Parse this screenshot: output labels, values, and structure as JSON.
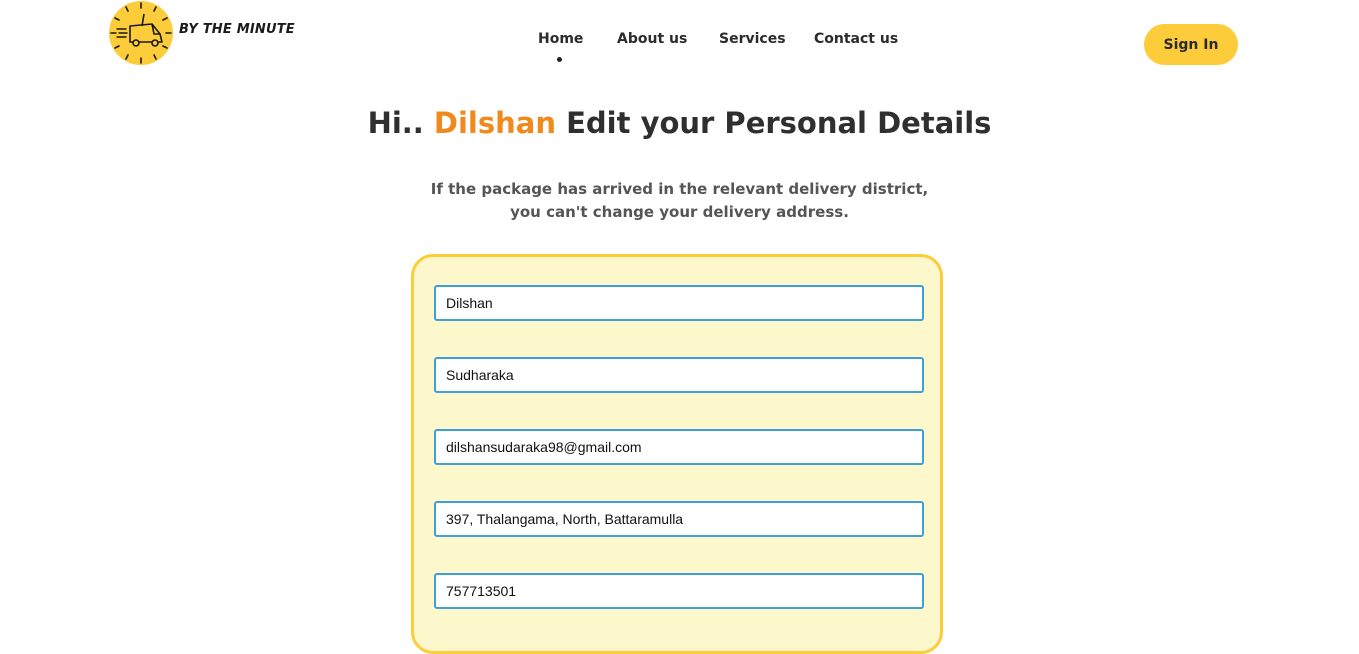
{
  "header": {
    "brand": "BY THE MINUTE",
    "nav": [
      {
        "label": "Home",
        "active": true
      },
      {
        "label": "About us",
        "active": false
      },
      {
        "label": "Services",
        "active": false
      },
      {
        "label": "Contact us",
        "active": false
      }
    ],
    "signin_label": "Sign In"
  },
  "main": {
    "title_prefix": "Hi.. ",
    "user_name": "Dilshan",
    "title_suffix": " Edit your Personal Details",
    "subtitle_line1": "If the package has arrived in the relevant delivery district,",
    "subtitle_line2": "you can't change your delivery address."
  },
  "form": {
    "first_name": "Dilshan",
    "last_name": "Sudharaka",
    "email": "dilshansudaraka98@gmail.com",
    "address": "397, Thalangama, North, Battaramulla",
    "phone": "757713501"
  },
  "colors": {
    "accent_yellow": "#fccc3a",
    "name_orange": "#f08a1c",
    "form_bg": "#fdf7cc",
    "input_border": "#3fa0d8"
  },
  "icons": {
    "logo": "clock-delivery-truck-icon",
    "active_nav_indicator": "dot-icon"
  }
}
